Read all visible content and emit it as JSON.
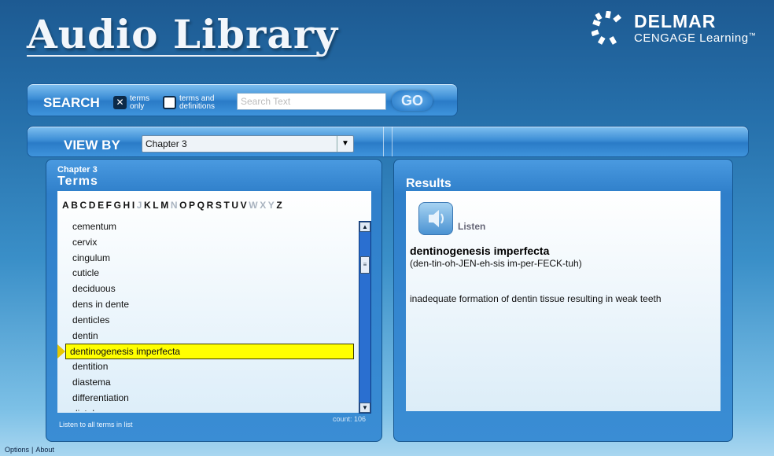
{
  "header": {
    "title": "Audio Library",
    "logo": {
      "line1": "DELMAR",
      "line2": "CENGAGE Learning",
      "trademark": "™"
    }
  },
  "search": {
    "label": "SEARCH",
    "option_terms_only": {
      "label_line1": "terms",
      "label_line2": "only",
      "checked": true
    },
    "option_terms_defs": {
      "label_line1": "terms and",
      "label_line2": "definitions",
      "checked": false
    },
    "placeholder": "Search Text",
    "go_label": "GO"
  },
  "view_by": {
    "label": "VIEW BY",
    "selected": "Chapter 3"
  },
  "terms_panel": {
    "chapter": "Chapter 3",
    "title": "Terms",
    "alphabet": [
      {
        "l": "A",
        "on": true
      },
      {
        "l": "B",
        "on": true
      },
      {
        "l": "C",
        "on": true
      },
      {
        "l": "D",
        "on": true
      },
      {
        "l": "E",
        "on": true
      },
      {
        "l": "F",
        "on": true
      },
      {
        "l": "G",
        "on": true
      },
      {
        "l": "H",
        "on": true
      },
      {
        "l": "I",
        "on": true
      },
      {
        "l": "J",
        "on": false
      },
      {
        "l": "K",
        "on": true
      },
      {
        "l": "L",
        "on": true
      },
      {
        "l": "M",
        "on": true
      },
      {
        "l": "N",
        "on": false
      },
      {
        "l": "O",
        "on": true
      },
      {
        "l": "P",
        "on": true
      },
      {
        "l": "Q",
        "on": true
      },
      {
        "l": "R",
        "on": true
      },
      {
        "l": "S",
        "on": true
      },
      {
        "l": "T",
        "on": true
      },
      {
        "l": "U",
        "on": true
      },
      {
        "l": "V",
        "on": true
      },
      {
        "l": "W",
        "on": false
      },
      {
        "l": "X",
        "on": false
      },
      {
        "l": "Y",
        "on": false
      },
      {
        "l": "Z",
        "on": true
      }
    ],
    "items": [
      "cementum",
      "cervix",
      "cingulum",
      "cuticle",
      "deciduous",
      "dens in dente",
      "denticles",
      "dentin",
      "dentinogenesis imperfecta",
      "dentition",
      "diastema",
      "differentiation",
      "distal"
    ],
    "selected_index": 8,
    "count_text": "count: 106",
    "listen_all": "Listen to all terms in list"
  },
  "results_panel": {
    "title": "Results",
    "listen_label": "Listen",
    "term": "dentinogenesis imperfecta",
    "pronunciation": "(den-tin-oh-JEN-eh-sis im-per-FECK-tuh)",
    "definition": "inadequate formation of dentin tissue resulting in weak teeth"
  },
  "footer": {
    "options": "Options",
    "about": "About"
  }
}
